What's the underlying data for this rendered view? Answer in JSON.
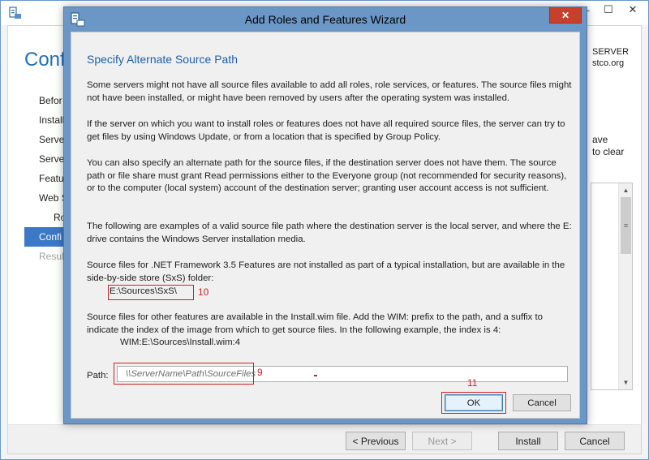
{
  "background_window": {
    "heading": "Confi",
    "nav_items": [
      {
        "label": "Befor",
        "state": "normal",
        "level": 0
      },
      {
        "label": "Install",
        "state": "normal",
        "level": 0
      },
      {
        "label": "Serve",
        "state": "normal",
        "level": 0
      },
      {
        "label": "Serve",
        "state": "normal",
        "level": 0
      },
      {
        "label": "Featu",
        "state": "normal",
        "level": 0
      },
      {
        "label": "Web S",
        "state": "normal",
        "level": 0
      },
      {
        "label": "Ro",
        "state": "normal",
        "level": 1
      },
      {
        "label": "Confi",
        "state": "active",
        "level": 0
      },
      {
        "label": "Result",
        "state": "disabled",
        "level": 0
      }
    ],
    "server_info_line1": "SERVER",
    "server_info_line2": "stco.org",
    "side_text_line1": "ave",
    "side_text_line2": "to clear",
    "buttons": {
      "previous": "< Previous",
      "next": "Next >",
      "install": "Install",
      "cancel": "Cancel"
    },
    "caption_buttons": {
      "minimize": "—",
      "maximize": "☐",
      "close": "✕"
    }
  },
  "dialog": {
    "title": "Add Roles and Features Wizard",
    "close_glyph": "✕",
    "heading": "Specify Alternate Source Path",
    "paragraph1": "Some servers might not have all source files available to add all roles, role services, or features. The source files might not have been installed, or might have been removed by users after the operating system was installed.",
    "paragraph2": "If the server on which you want to install roles or features does not have all required source files, the server can try to get files by using Windows Update, or from a location that is specified by Group Policy.",
    "paragraph3": "You can also specify an alternate path for the source files, if the destination server does not have them. The source path or file share must grant Read permissions either to the Everyone group (not recommended for security reasons), or to the computer (local system) account of the destination server; granting user account access is not sufficient.",
    "paragraph4": "The following are examples of a valid source file path where the destination server is the local server, and where the E: drive contains the Windows Server installation media.",
    "paragraph5": "Source files for .NET Framework 3.5 Features are not installed as part of a typical installation, but are available in the side-by-side store (SxS) folder:",
    "sxs_path": "E:\\Sources\\SxS\\",
    "paragraph6": "Source files for other features are available in the Install.wim file. Add the WIM: prefix to the path, and a suffix to indicate the index of the image from which to get source files. In the following example, the index is 4:",
    "wim_path": "WIM:E:\\Sources\\Install.wim:4",
    "path_label": "Path:",
    "path_value": "",
    "path_placeholder": "\\\\ServerName\\Path\\SourceFiles",
    "ok_label": "OK",
    "cancel_label": "Cancel",
    "annotations": {
      "sxs": "10",
      "path": "9",
      "ok": "11"
    }
  },
  "colors": {
    "dialog_frame": "#6b97c7",
    "heading_blue": "#1e5fa8",
    "annotation_red": "#d11f1f",
    "close_button": "#c7402b",
    "nav_active": "#3b78c6"
  }
}
